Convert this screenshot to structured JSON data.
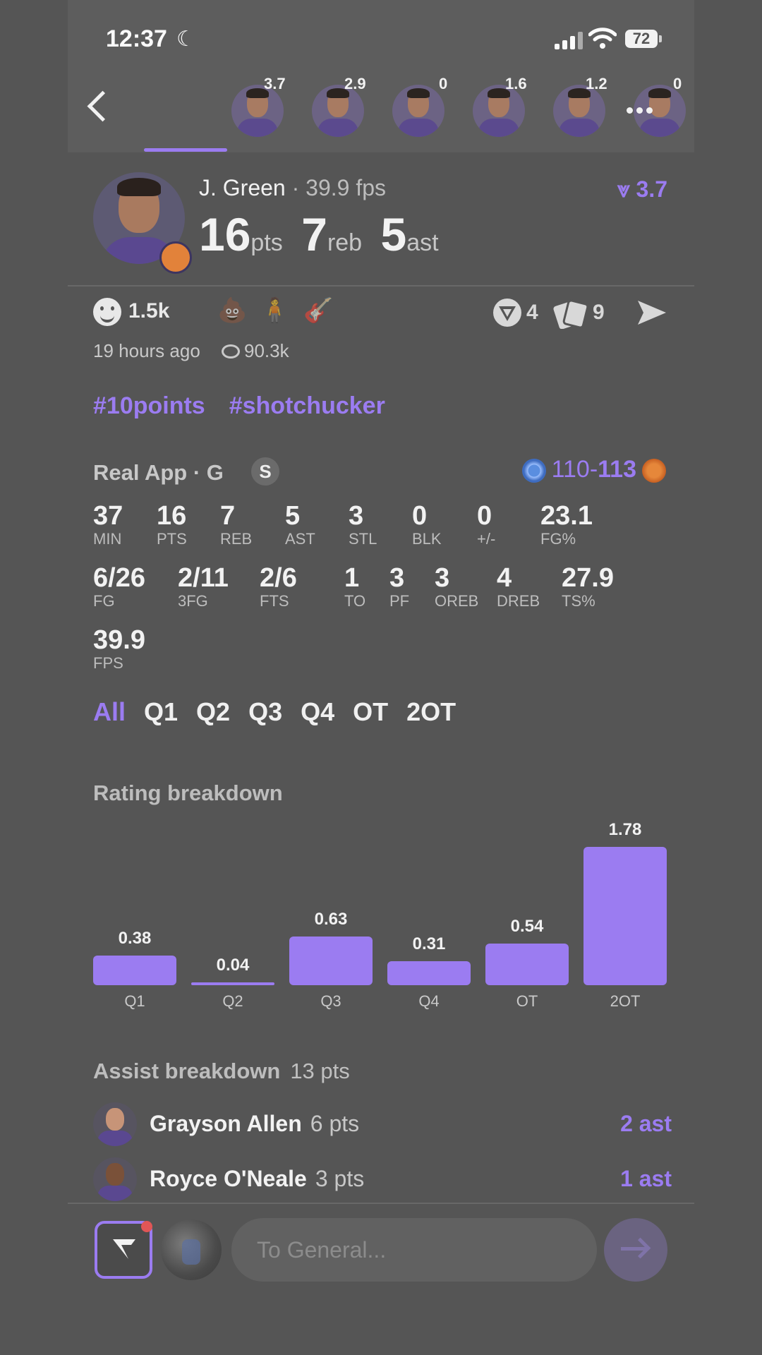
{
  "status_bar": {
    "time": "12:37",
    "battery": "72"
  },
  "players_strip": {
    "scores": [
      "3.7",
      "2.9",
      "0",
      "1.6",
      "1.2",
      "0"
    ],
    "selected_index": 0
  },
  "player": {
    "name": "J. Green",
    "fps_text": "· 39.9 fps",
    "rating": "3.7",
    "pts": "16",
    "pts_label": "pts",
    "reb": "7",
    "reb_label": "reb",
    "ast": "5",
    "ast_label": "ast"
  },
  "reactions": {
    "count": "1.5k",
    "emojis": [
      "💩",
      "🧍",
      "🎸"
    ],
    "predictions_count": "4",
    "cards_count": "9",
    "time_ago": "19 hours ago",
    "views": "90.3k"
  },
  "tags": [
    "#10points",
    "#shotchucker"
  ],
  "game": {
    "label": "Real App · G",
    "badge": "S",
    "score_left": "110-",
    "score_right": "113"
  },
  "stats": [
    {
      "value": "37",
      "label": "MIN"
    },
    {
      "value": "16",
      "label": "PTS"
    },
    {
      "value": "7",
      "label": "REB"
    },
    {
      "value": "5",
      "label": "AST"
    },
    {
      "value": "3",
      "label": "STL"
    },
    {
      "value": "0",
      "label": "BLK"
    },
    {
      "value": "0",
      "label": "+/-"
    },
    {
      "value": "23.1",
      "label": "FG%"
    },
    {
      "value": "6/26",
      "label": "FG"
    },
    {
      "value": "2/11",
      "label": "3FG"
    },
    {
      "value": "2/6",
      "label": "FTS"
    },
    {
      "value": "1",
      "label": "TO"
    },
    {
      "value": "3",
      "label": "PF"
    },
    {
      "value": "3",
      "label": "OREB"
    },
    {
      "value": "4",
      "label": "DREB"
    },
    {
      "value": "27.9",
      "label": "TS%"
    },
    {
      "value": "39.9",
      "label": "FPS"
    }
  ],
  "quarter_tabs": [
    "All",
    "Q1",
    "Q2",
    "Q3",
    "Q4",
    "OT",
    "2OT"
  ],
  "rating_title": "Rating breakdown",
  "chart_data": {
    "type": "bar",
    "categories": [
      "Q1",
      "Q2",
      "Q3",
      "Q4",
      "OT",
      "2OT"
    ],
    "values": [
      0.38,
      0.04,
      0.63,
      0.31,
      0.54,
      1.78
    ],
    "value_labels": [
      "0.38",
      "0.04",
      "0.63",
      "0.31",
      "0.54",
      "1.78"
    ],
    "title": "Rating breakdown",
    "ylim": [
      0,
      1.78
    ],
    "grid": false,
    "color": "#9b7cf1"
  },
  "assists": {
    "title": "Assist breakdown",
    "total": "13 pts",
    "rows": [
      {
        "name": "Grayson Allen",
        "pts": "6 pts",
        "ast": "2 ast"
      },
      {
        "name": "Royce O'Neale",
        "pts": "3 pts",
        "ast": "1 ast"
      }
    ]
  },
  "composer": {
    "placeholder": "To General..."
  },
  "colors": {
    "accent": "#9b7cf1",
    "background": "#555555",
    "notification": "#e05656"
  },
  "icons": [
    "back-icon",
    "more-icon",
    "smile-icon",
    "prediction-icon",
    "cards-icon",
    "send-icon",
    "eye-icon",
    "app-logo-icon",
    "send-arrow-icon"
  ]
}
